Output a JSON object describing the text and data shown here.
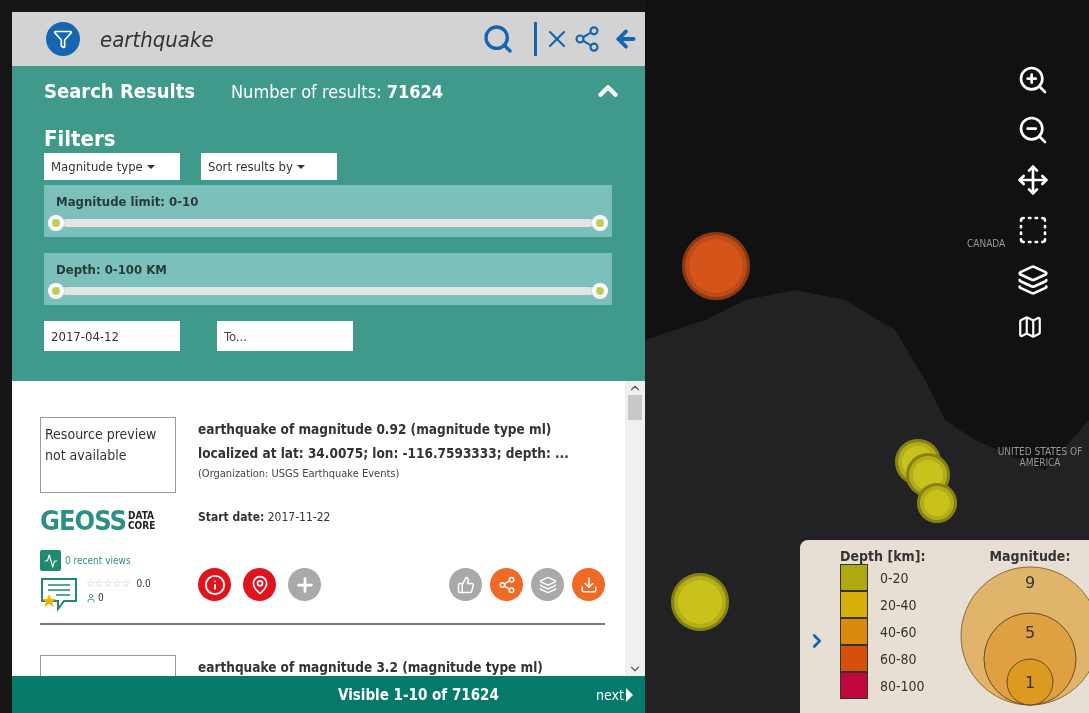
{
  "search": {
    "query": "earthquake"
  },
  "results_header": {
    "title": "Search Results",
    "count_label": "Number of results:",
    "count": "71624",
    "expanded": true
  },
  "filters": {
    "title": "Filters",
    "dropdowns": [
      "Magnitude type",
      "Sort results by"
    ],
    "sliders": [
      {
        "label": "Magnitude limit: 0-10",
        "level": 1
      },
      {
        "label": "Depth: 0-100 KM",
        "level": 1
      }
    ],
    "dates": [
      {
        "value": "2017-04-12"
      },
      {
        "placeholder": "To..."
      }
    ]
  },
  "results": [
    {
      "preview": "Resource preview not available",
      "logo": {
        "name": "GEOSS",
        "sub": [
          "DATA",
          "CORE"
        ]
      },
      "views": "0 recent views",
      "stars": 0,
      "rating": "0.0",
      "reviewers": "0",
      "title": "earthquake of magnitude 0.92 (magnitude type ml)",
      "subtitle": "localized at lat: 34.0075; lon: -116.7593333; depth: ...",
      "organization": "(Organization: USGS Earthquake Events)",
      "start_label": "Start date:",
      "start_date": "2017-11-22",
      "actions": [
        {
          "kind": "info",
          "disabled": false
        },
        {
          "kind": "pin",
          "disabled": false
        },
        {
          "kind": "add",
          "disabled": true
        }
      ],
      "tools": [
        {
          "kind": "like",
          "disabled": true
        },
        {
          "kind": "share",
          "disabled": false
        },
        {
          "kind": "layers",
          "disabled": true
        },
        {
          "kind": "download",
          "disabled": false
        }
      ]
    },
    {
      "title": "earthquake of magnitude 3.2 (magnitude type ml)"
    }
  ],
  "footer": {
    "visible": "Visible 1-10 of 71624",
    "next": "next"
  },
  "map": {
    "labels": [
      "CANADA",
      "UNITED STATES OF AMERICA"
    ],
    "markers": [
      {
        "color": "#d4541a"
      },
      {
        "color": "#c8c21a"
      },
      {
        "color": "#c8c21a"
      },
      {
        "color": "#c8c21a"
      },
      {
        "color": "#c8c21a"
      }
    ],
    "controls": [
      {
        "kind": "zoom-in"
      },
      {
        "kind": "zoom-out"
      },
      {
        "kind": "pan"
      },
      {
        "kind": "select-area"
      },
      {
        "kind": "layers"
      },
      {
        "kind": "basemap"
      }
    ]
  },
  "legend": {
    "depth_title": "Depth [km]:",
    "depths": [
      {
        "label": "0-20",
        "color": "#b0a810"
      },
      {
        "label": "20-40",
        "color": "#d8b00a"
      },
      {
        "label": "40-60",
        "color": "#d98a0a"
      },
      {
        "label": "60-80",
        "color": "#d6500c"
      },
      {
        "label": "80-100",
        "color": "#c0063c"
      }
    ],
    "magnitude_title": "Magnitude:",
    "magnitudes": [
      "9",
      "5",
      "1"
    ]
  }
}
